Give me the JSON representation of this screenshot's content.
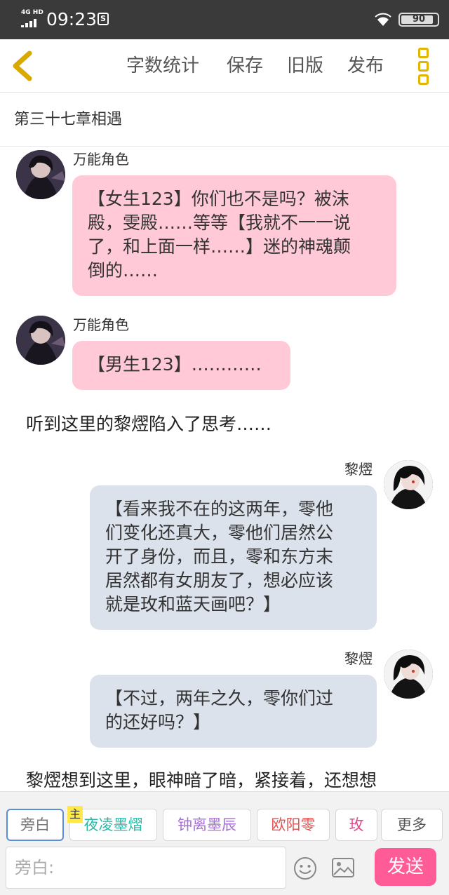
{
  "status_bar": {
    "network": "4G HD",
    "time": "09:23",
    "app_badge": "S",
    "battery": "90",
    "battery_level": 0.9
  },
  "toolbar": {
    "word_count": "字数统计",
    "save": "保存",
    "old_version": "旧版",
    "publish": "发布"
  },
  "chapter": {
    "title": "第三十七章相遇"
  },
  "messages": [
    {
      "name": "万能角色",
      "lines": [
        "【女生123】你们也不是吗？被沫",
        "殿，雯殿……等等【我就不一一说",
        "了，和上面一样……】迷的神魂颠",
        "倒的……"
      ]
    },
    {
      "name": "万能角色",
      "lines": [
        "【男生123】…………"
      ]
    },
    {
      "narration": "听到这里的黎熤陷入了思考……"
    },
    {
      "name": "黎熤",
      "lines": [
        "【看来我不在的这两年，零他",
        "们变化还真大，零他们居然公",
        "开了身份，而且，零和东方末",
        "居然都有女朋友了，想必应该",
        "就是玫和蓝天画吧？】"
      ]
    },
    {
      "name": "黎熤",
      "lines": [
        "【不过，两年之久，零你们过",
        "的还好吗？】"
      ]
    },
    {
      "narration": "黎熤想到这里，眼神暗了暗，紧接着，还想想"
    }
  ],
  "roles": {
    "main_tag": "主",
    "items": [
      {
        "label": "旁白",
        "color": "#777777"
      },
      {
        "label": "夜凌墨熠",
        "color": "#2bb8a6"
      },
      {
        "label": "钟离墨辰",
        "color": "#a770d3"
      },
      {
        "label": "欧阳零",
        "color": "#e25555"
      },
      {
        "label": "玫",
        "color": "#e04a8a"
      },
      {
        "label": "更多",
        "color": "#555555"
      }
    ]
  },
  "input": {
    "placeholder": "旁白:"
  },
  "send_label": "发送",
  "colors": {
    "accent": "#e3b500",
    "send": "#ff5c97",
    "bubble_pink": "#ffc9d8",
    "bubble_blue": "#dce2ec",
    "selected_border": "#5b8ed6"
  }
}
